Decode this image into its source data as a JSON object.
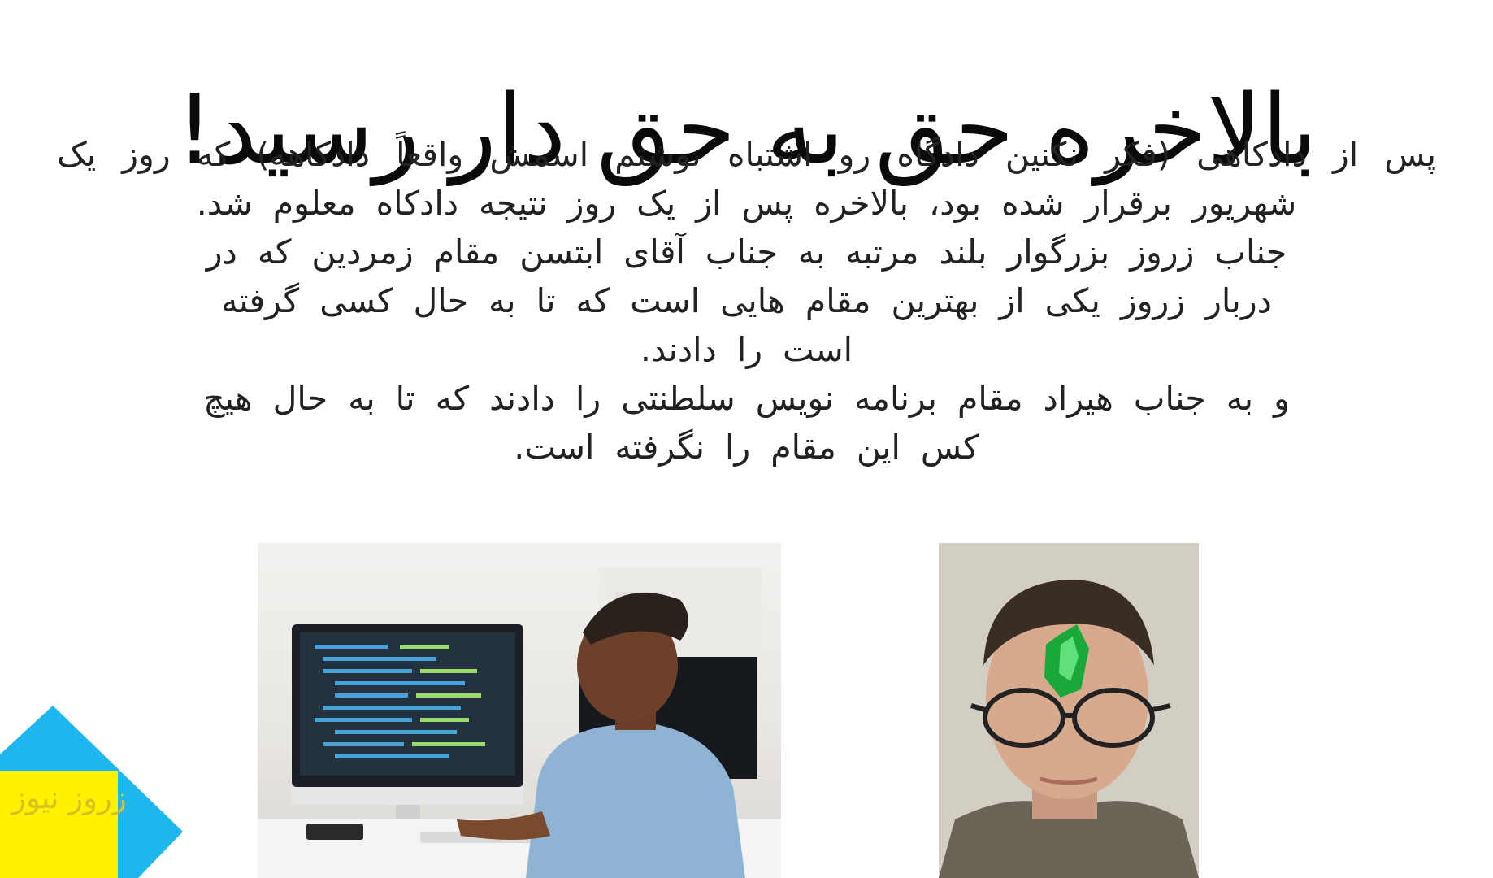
{
  "article": {
    "title": "بالاخره حق به حق دار رسید!",
    "paragraphs": [
      "پس از دادکاهی (فکر نکنین دادگاه رو اشتباه نوشتم اسمش واقعاً دادکاهه) که روز یک شهریور برقرار شده بود، بالاخره پس از یک روز نتیجه دادکاه معلوم شد.",
      "جناب زروز بزرگوار بلند مرتبه به جناب آقای ابتسن مقام زمردین که در دربار زروز یکی از بهترین مقام هایی است که تا به حال کسی گرفته است را دادند.",
      "و به جناب هیراد مقام برنامه نویس سلطنتی را دادند که تا به حال هیچ کس این مقام را نگرفته است."
    ]
  },
  "logo": {
    "text": "زروز نیوز",
    "triangle_color": "#1eb6ef",
    "square_color": "#fff200",
    "text_color": "#d8c020"
  }
}
